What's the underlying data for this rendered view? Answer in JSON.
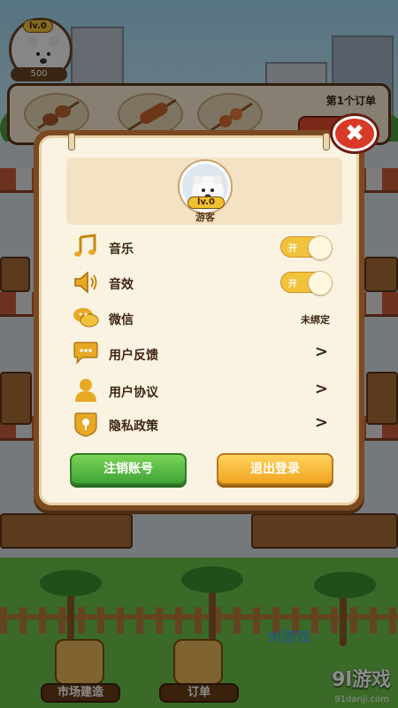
{
  "hud": {
    "level": "lv.0",
    "coins": "500"
  },
  "order_bar": {
    "label": "第1个订单"
  },
  "dialog": {
    "close_symbol": "✖",
    "profile": {
      "level": "lv.0",
      "name": "游客"
    },
    "settings": [
      {
        "key": "music",
        "icon": "music-note-icon",
        "label": "音乐",
        "control": "toggle",
        "toggle_text": "开",
        "on": true
      },
      {
        "key": "sfx",
        "icon": "speaker-icon",
        "label": "音效",
        "control": "toggle",
        "toggle_text": "开",
        "on": true
      },
      {
        "key": "wechat",
        "icon": "wechat-icon",
        "label": "微信",
        "control": "value",
        "value": "未绑定"
      },
      {
        "key": "feedback",
        "icon": "chat-bubble-icon",
        "label": "用户反馈",
        "control": "arrow",
        "arrow": ">"
      },
      {
        "key": "agreement",
        "icon": "user-icon",
        "label": "用户协议",
        "control": "arrow",
        "arrow": ">"
      },
      {
        "key": "privacy",
        "icon": "shield-icon",
        "label": "隐私政策",
        "control": "arrow",
        "arrow": ">"
      }
    ],
    "buttons": {
      "cancel_account": "注销账号",
      "logout": "退出登录"
    }
  },
  "bottom_bar": {
    "market": "市场建造",
    "orders": "订单"
  },
  "watermark": {
    "brand": "9l游戏",
    "url": "91danji.com",
    "mid_brand": "9l游戏"
  },
  "colors": {
    "dialog_border": "#7a4a22",
    "dialog_fill": "#fbf3e2",
    "toggle_on": "#f2c33a",
    "green_button": "#3fa436",
    "yellow_button": "#f0a421",
    "close_red": "#d83a27"
  }
}
